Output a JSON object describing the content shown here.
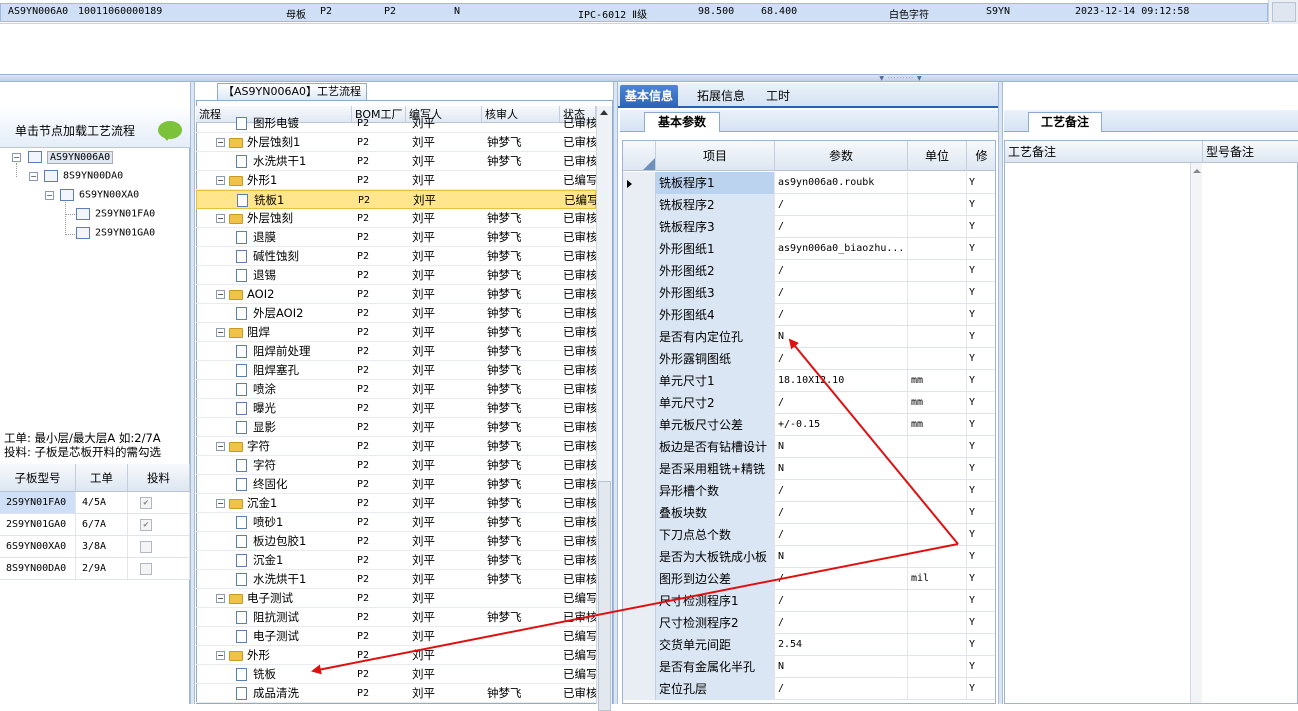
{
  "top_row": {
    "cells": [
      "AS9YN006A0",
      "10011060000189",
      "母板",
      "P2",
      "P2",
      "N",
      "IPC-6012 Ⅱ级",
      "98.500",
      "68.400",
      "白色字符",
      "S9YN",
      "2023-12-14 09:12:58"
    ]
  },
  "left_panel": {
    "header": "单击节点加载工艺流程",
    "tree": [
      "AS9YN006A0",
      "8S9YN00DA0",
      "6S9YN00XA0",
      "2S9YN01FA0",
      "2S9YN01GA0"
    ],
    "note_line1": "工单: 最小层/最大层A 如:2/7A",
    "note_line2": "投料: 子板是芯板开料的需勾选",
    "table": {
      "headers": [
        "子板型号",
        "工单",
        "投料"
      ],
      "rows": [
        {
          "model": "2S9YN01FA0",
          "order": "4/5A",
          "checked": true
        },
        {
          "model": "2S9YN01GA0",
          "order": "6/7A",
          "checked": true
        },
        {
          "model": "6S9YN00XA0",
          "order": "3/8A",
          "checked": false
        },
        {
          "model": "8S9YN00DA0",
          "order": "2/9A",
          "checked": false
        }
      ]
    }
  },
  "process": {
    "title": "【AS9YN006A0】工艺流程",
    "headers": [
      "流程",
      "BOM工厂",
      "编写人",
      "核审人",
      "状态"
    ],
    "rows": [
      {
        "name": "图形电镀",
        "level": 2,
        "kind": "doc",
        "bom": "P2",
        "author": "刘平",
        "reviewer": "",
        "status": "已审核"
      },
      {
        "name": "外层蚀刻1",
        "level": 1,
        "kind": "folder",
        "bom": "P2",
        "author": "刘平",
        "reviewer": "钟梦飞",
        "status": "已审核"
      },
      {
        "name": "水洗烘干1",
        "level": 2,
        "kind": "doc",
        "bom": "P2",
        "author": "刘平",
        "reviewer": "钟梦飞",
        "status": "已审核"
      },
      {
        "name": "外形1",
        "level": 1,
        "kind": "folder",
        "bom": "P2",
        "author": "刘平",
        "reviewer": "",
        "status": "已编写"
      },
      {
        "name": "铣板1",
        "level": 2,
        "kind": "doc",
        "bom": "P2",
        "author": "刘平",
        "reviewer": "",
        "status": "已编写",
        "highlight": true
      },
      {
        "name": "外层蚀刻",
        "level": 1,
        "kind": "folder",
        "bom": "P2",
        "author": "刘平",
        "reviewer": "钟梦飞",
        "status": "已审核"
      },
      {
        "name": "退膜",
        "level": 2,
        "kind": "doc",
        "bom": "P2",
        "author": "刘平",
        "reviewer": "钟梦飞",
        "status": "已审核"
      },
      {
        "name": "碱性蚀刻",
        "level": 2,
        "kind": "doc",
        "bom": "P2",
        "author": "刘平",
        "reviewer": "钟梦飞",
        "status": "已审核"
      },
      {
        "name": "退锡",
        "level": 2,
        "kind": "doc",
        "bom": "P2",
        "author": "刘平",
        "reviewer": "钟梦飞",
        "status": "已审核"
      },
      {
        "name": "AOI2",
        "level": 1,
        "kind": "folder",
        "bom": "P2",
        "author": "刘平",
        "reviewer": "钟梦飞",
        "status": "已审核"
      },
      {
        "name": "外层AOI2",
        "level": 2,
        "kind": "doc",
        "bom": "P2",
        "author": "刘平",
        "reviewer": "钟梦飞",
        "status": "已审核"
      },
      {
        "name": "阻焊",
        "level": 1,
        "kind": "folder",
        "bom": "P2",
        "author": "刘平",
        "reviewer": "钟梦飞",
        "status": "已审核"
      },
      {
        "name": "阻焊前处理",
        "level": 2,
        "kind": "doc",
        "bom": "P2",
        "author": "刘平",
        "reviewer": "钟梦飞",
        "status": "已审核"
      },
      {
        "name": "阻焊塞孔",
        "level": 2,
        "kind": "doc",
        "bom": "P2",
        "author": "刘平",
        "reviewer": "钟梦飞",
        "status": "已审核"
      },
      {
        "name": "喷涂",
        "level": 2,
        "kind": "doc",
        "bom": "P2",
        "author": "刘平",
        "reviewer": "钟梦飞",
        "status": "已审核"
      },
      {
        "name": "曝光",
        "level": 2,
        "kind": "doc",
        "bom": "P2",
        "author": "刘平",
        "reviewer": "钟梦飞",
        "status": "已审核"
      },
      {
        "name": "显影",
        "level": 2,
        "kind": "doc",
        "bom": "P2",
        "author": "刘平",
        "reviewer": "钟梦飞",
        "status": "已审核"
      },
      {
        "name": "字符",
        "level": 1,
        "kind": "folder",
        "bom": "P2",
        "author": "刘平",
        "reviewer": "钟梦飞",
        "status": "已审核"
      },
      {
        "name": "字符",
        "level": 2,
        "kind": "doc",
        "bom": "P2",
        "author": "刘平",
        "reviewer": "钟梦飞",
        "status": "已审核"
      },
      {
        "name": "终固化",
        "level": 2,
        "kind": "doc",
        "bom": "P2",
        "author": "刘平",
        "reviewer": "钟梦飞",
        "status": "已审核"
      },
      {
        "name": "沉金1",
        "level": 1,
        "kind": "folder",
        "bom": "P2",
        "author": "刘平",
        "reviewer": "钟梦飞",
        "status": "已审核"
      },
      {
        "name": "喷砂1",
        "level": 2,
        "kind": "doc",
        "bom": "P2",
        "author": "刘平",
        "reviewer": "钟梦飞",
        "status": "已审核"
      },
      {
        "name": "板边包胶1",
        "level": 2,
        "kind": "doc",
        "bom": "P2",
        "author": "刘平",
        "reviewer": "钟梦飞",
        "status": "已审核"
      },
      {
        "name": "沉金1",
        "level": 2,
        "kind": "doc",
        "bom": "P2",
        "author": "刘平",
        "reviewer": "钟梦飞",
        "status": "已审核"
      },
      {
        "name": "水洗烘干1",
        "level": 2,
        "kind": "doc",
        "bom": "P2",
        "author": "刘平",
        "reviewer": "钟梦飞",
        "status": "已审核"
      },
      {
        "name": "电子测试",
        "level": 1,
        "kind": "folder",
        "bom": "P2",
        "author": "刘平",
        "reviewer": "",
        "status": "已编写"
      },
      {
        "name": "阻抗测试",
        "level": 2,
        "kind": "doc",
        "bom": "P2",
        "author": "刘平",
        "reviewer": "钟梦飞",
        "status": "已审核"
      },
      {
        "name": "电子测试",
        "level": 2,
        "kind": "doc",
        "bom": "P2",
        "author": "刘平",
        "reviewer": "",
        "status": "已编写"
      },
      {
        "name": "外形",
        "level": 1,
        "kind": "folder",
        "bom": "P2",
        "author": "刘平",
        "reviewer": "",
        "status": "已编写"
      },
      {
        "name": "铣板",
        "level": 2,
        "kind": "doc",
        "bom": "P2",
        "author": "刘平",
        "reviewer": "",
        "status": "已编写"
      },
      {
        "name": "成品清洗",
        "level": 2,
        "kind": "doc",
        "bom": "P2",
        "author": "刘平",
        "reviewer": "钟梦飞",
        "status": "已审核"
      }
    ]
  },
  "right_tabs": [
    "基本信息",
    "拓展信息",
    "工时"
  ],
  "basic_params": {
    "subtab": "基本参数",
    "headers": [
      "项目",
      "参数",
      "单位",
      "修"
    ],
    "rows": [
      {
        "item": "铣板程序1",
        "value": "as9yn006a0.roubk",
        "unit": "",
        "flag": "Y"
      },
      {
        "item": "铣板程序2",
        "value": "/",
        "unit": "",
        "flag": "Y"
      },
      {
        "item": "铣板程序3",
        "value": "/",
        "unit": "",
        "flag": "Y"
      },
      {
        "item": "外形图纸1",
        "value": "as9yn006a0_biaozhu...",
        "unit": "",
        "flag": "Y"
      },
      {
        "item": "外形图纸2",
        "value": "/",
        "unit": "",
        "flag": "Y"
      },
      {
        "item": "外形图纸3",
        "value": "/",
        "unit": "",
        "flag": "Y"
      },
      {
        "item": "外形图纸4",
        "value": "/",
        "unit": "",
        "flag": "Y"
      },
      {
        "item": "是否有内定位孔",
        "value": "N",
        "unit": "",
        "flag": "Y"
      },
      {
        "item": "外形露铜图纸",
        "value": "/",
        "unit": "",
        "flag": "Y"
      },
      {
        "item": "单元尺寸1",
        "value": "18.10X12.10",
        "unit": "mm",
        "flag": "Y"
      },
      {
        "item": "单元尺寸2",
        "value": "/",
        "unit": "mm",
        "flag": "Y"
      },
      {
        "item": "单元板尺寸公差",
        "value": "+/-0.15",
        "unit": "mm",
        "flag": "Y"
      },
      {
        "item": "板边是否有钻槽设计",
        "value": "N",
        "unit": "",
        "flag": "Y"
      },
      {
        "item": "是否采用粗铣+精铣",
        "value": "N",
        "unit": "",
        "flag": "Y"
      },
      {
        "item": "异形槽个数",
        "value": "/",
        "unit": "",
        "flag": "Y"
      },
      {
        "item": "叠板块数",
        "value": "/",
        "unit": "",
        "flag": "Y"
      },
      {
        "item": "下刀点总个数",
        "value": "/",
        "unit": "",
        "flag": "Y"
      },
      {
        "item": "是否为大板铣成小板",
        "value": "N",
        "unit": "",
        "flag": "Y"
      },
      {
        "item": "图形到边公差",
        "value": "/",
        "unit": "mil",
        "flag": "Y"
      },
      {
        "item": "尺寸检测程序1",
        "value": "/",
        "unit": "",
        "flag": "Y"
      },
      {
        "item": "尺寸检测程序2",
        "value": "/",
        "unit": "",
        "flag": "Y"
      },
      {
        "item": "交货单元间距",
        "value": "2.54",
        "unit": "",
        "flag": "Y"
      },
      {
        "item": "是否有金属化半孔",
        "value": "N",
        "unit": "",
        "flag": "Y"
      },
      {
        "item": "定位孔层",
        "value": "/",
        "unit": "",
        "flag": "Y"
      }
    ]
  },
  "remarks": {
    "tab": "工艺备注",
    "headers": [
      "工艺备注",
      "型号备注"
    ]
  },
  "colors": {
    "accent": "#2b63b4",
    "highlight": "#ffe68c",
    "arrow": "#e01010"
  }
}
